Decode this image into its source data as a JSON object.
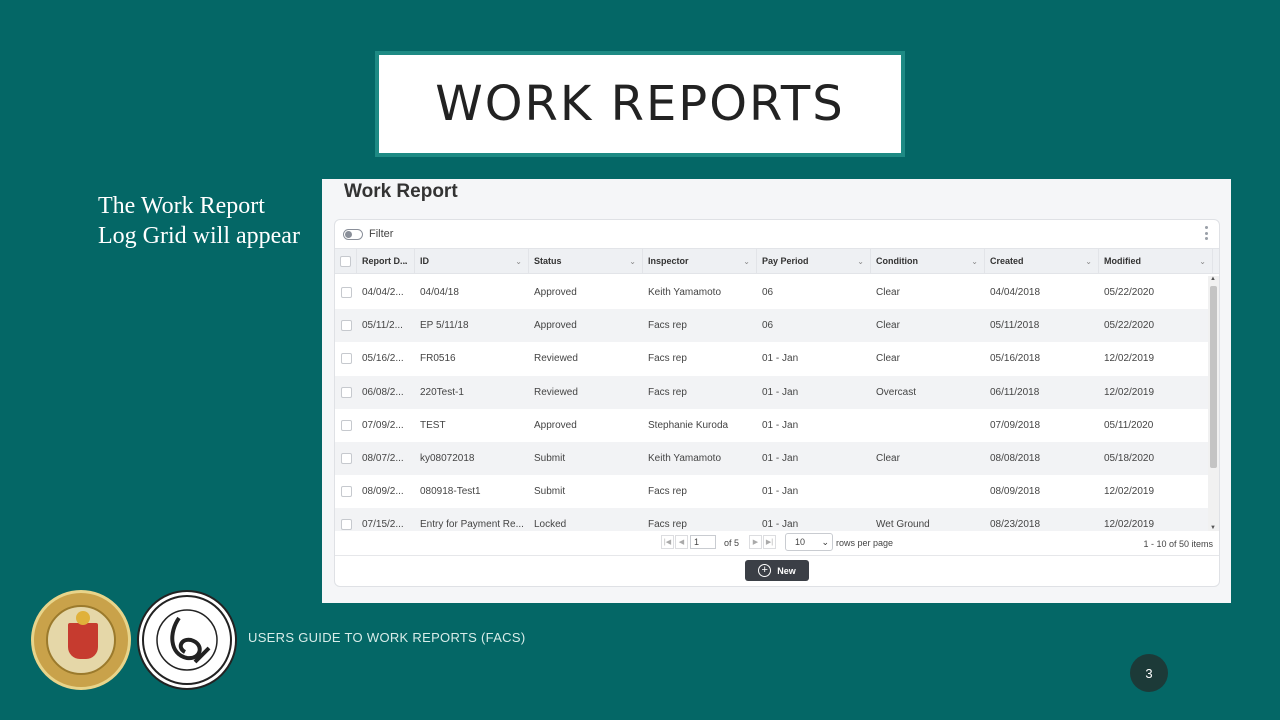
{
  "slide": {
    "title": "WORK REPORTS",
    "side_text_line1": "The Work Report",
    "side_text_line2": "Log Grid will appear",
    "footer": "USERS GUIDE TO WORK REPORTS  (FACS)",
    "page_number": "3",
    "colors": {
      "background": "#046766",
      "title_border": "#1e8a84",
      "page_badge": "#1c3a38"
    }
  },
  "app": {
    "title": "Work Report",
    "filter_label": "Filter",
    "columns": [
      "Report D...",
      "ID",
      "Status",
      "Inspector",
      "Pay Period",
      "Condition",
      "Created",
      "Modified"
    ],
    "rows": [
      [
        "04/04/2...",
        "04/04/18",
        "Approved",
        "Keith Yamamoto",
        "06",
        "Clear",
        "04/04/2018",
        "05/22/2020"
      ],
      [
        "05/11/2...",
        "EP 5/11/18",
        "Approved",
        "Facs rep",
        "06",
        "Clear",
        "05/11/2018",
        "05/22/2020"
      ],
      [
        "05/16/2...",
        "FR0516",
        "Reviewed",
        "Facs rep",
        "01 - Jan",
        "Clear",
        "05/16/2018",
        "12/02/2019"
      ],
      [
        "06/08/2...",
        "220Test-1",
        "Reviewed",
        "Facs rep",
        "01 - Jan",
        "Overcast",
        "06/11/2018",
        "12/02/2019"
      ],
      [
        "07/09/2...",
        "TEST",
        "Approved",
        "Stephanie Kuroda",
        "01 - Jan",
        "",
        "07/09/2018",
        "05/11/2020"
      ],
      [
        "08/07/2...",
        "ky08072018",
        "Submit",
        "Keith Yamamoto",
        "01 - Jan",
        "Clear",
        "08/08/2018",
        "05/18/2020"
      ],
      [
        "08/09/2...",
        "080918-Test1",
        "Submit",
        "Facs rep",
        "01 - Jan",
        "",
        "08/09/2018",
        "12/02/2019"
      ],
      [
        "07/15/2...",
        "Entry for Payment Re...",
        "Locked",
        "Facs rep",
        "01 - Jan",
        "Wet Ground",
        "08/23/2018",
        "12/02/2019"
      ]
    ],
    "pager": {
      "current_page": "1",
      "of_pages": "of 5",
      "page_size": "10",
      "rows_per_page_label": "rows per page",
      "summary": "1 - 10 of 50 items"
    },
    "new_button": "New"
  }
}
